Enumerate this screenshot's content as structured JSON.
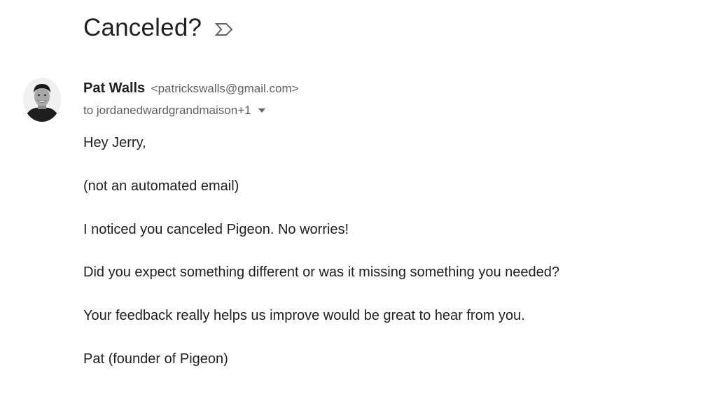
{
  "email": {
    "subject": "Canceled?",
    "important_icon": "important-marker-icon",
    "sender": {
      "name": "Pat Walls",
      "address": "<patrickswalls@gmail.com>",
      "avatar_icon": "sender-avatar"
    },
    "recipients": "to jordanedwardgrandmaison+1",
    "body": [
      "Hey Jerry,",
      "(not an automated email)",
      "I noticed you canceled Pigeon. No worries!",
      "Did you expect something different or was it missing something you needed?",
      "Your feedback really helps us improve would be great to hear from you.",
      "Pat (founder of Pigeon)"
    ]
  },
  "colors": {
    "text_primary": "#202124",
    "text_secondary": "#5f6368"
  }
}
